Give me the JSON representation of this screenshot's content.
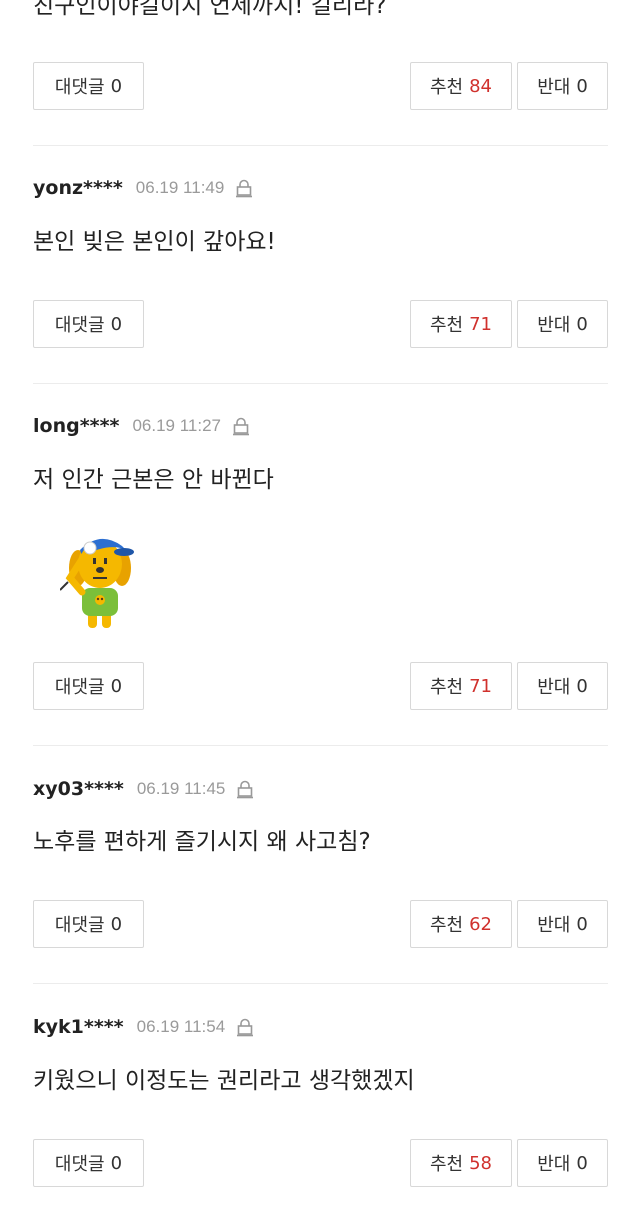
{
  "top_comment": {
    "text": "친구인이야길이지 언제까지! 길리라?",
    "reply_label": "대댓글",
    "reply_count": "0",
    "up_label": "추천",
    "up_count": "84",
    "down_label": "반대",
    "down_count": "0"
  },
  "comments": [
    {
      "user": "yonz****",
      "time": "06.19 11:49",
      "text": "본인 빚은 본인이 갚아요!",
      "reply_label": "대댓글",
      "reply_count": "0",
      "up_label": "추천",
      "up_count": "71",
      "down_label": "반대",
      "down_count": "0"
    },
    {
      "user": "long****",
      "time": "06.19 11:27",
      "text": "저 인간 근본은 안 바뀐다",
      "sticker": "saluting-dog-sticker",
      "reply_label": "대댓글",
      "reply_count": "0",
      "up_label": "추천",
      "up_count": "71",
      "down_label": "반대",
      "down_count": "0"
    },
    {
      "user": "xy03****",
      "time": "06.19 11:45",
      "text": "노후를 편하게 즐기시지 왜 사고침?",
      "reply_label": "대댓글",
      "reply_count": "0",
      "up_label": "추천",
      "up_count": "62",
      "down_label": "반대",
      "down_count": "0"
    },
    {
      "user": "kyk1****",
      "time": "06.19 11:54",
      "text": "키웠으니 이정도는 권리라고 생각했겠지",
      "reply_label": "대댓글",
      "reply_count": "0",
      "up_label": "추천",
      "up_count": "58",
      "down_label": "반대",
      "down_count": "0"
    }
  ],
  "colors": {
    "upvote_count": "#d0312d",
    "meta_gray": "#9a9a9a",
    "border": "#d8d8d8"
  },
  "icons": {
    "lock": "lock-icon"
  }
}
